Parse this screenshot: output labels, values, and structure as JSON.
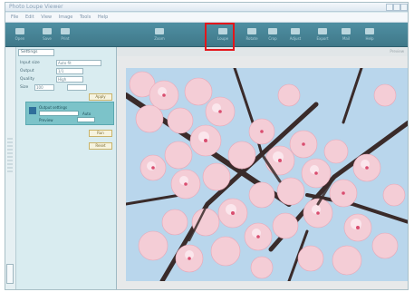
{
  "app": {
    "title": "Photo Loupe Viewer",
    "menu": [
      "File",
      "Edit",
      "View",
      "Image",
      "Tools",
      "Help"
    ]
  },
  "toolbar": {
    "buttons": [
      {
        "label": "Open",
        "icon": "folder-icon"
      },
      {
        "label": "Save",
        "icon": "save-icon"
      },
      {
        "label": "Print",
        "icon": "print-icon"
      },
      {
        "label": "Zoom",
        "icon": "zoom-icon"
      },
      {
        "label": "Loupe",
        "icon": "loupe-icon"
      },
      {
        "label": "Rotate",
        "icon": "rotate-icon"
      },
      {
        "label": "Crop",
        "icon": "crop-icon"
      },
      {
        "label": "Adjust",
        "icon": "adjust-icon"
      },
      {
        "label": "Export",
        "icon": "export-icon"
      },
      {
        "label": "Mail",
        "icon": "mail-icon"
      },
      {
        "label": "Help",
        "icon": "help-icon"
      }
    ],
    "highlight_color": "#e3161b"
  },
  "panel": {
    "header": "Settings",
    "rows": [
      {
        "label": "Input size",
        "value": "Auto fit"
      },
      {
        "label": "Output",
        "value": "1/1"
      },
      {
        "label": "Quality",
        "value": "High"
      },
      {
        "label": "Size",
        "value": "100"
      }
    ],
    "apply_button": "Apply",
    "teal_title": "Output settings",
    "teal_right": "Auto",
    "teal_bottom": "Preview",
    "button_a": "Run",
    "button_b": "Reset"
  },
  "canvas": {
    "top_right_label": "Preview"
  },
  "colors": {
    "toolbar": "#4f8fa2",
    "panel": "#d9ecf0",
    "sky": "#b8d4ea",
    "blossom": "#f2c9d3"
  }
}
